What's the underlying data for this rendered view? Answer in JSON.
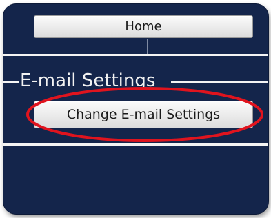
{
  "nav": {
    "home_label": "Home"
  },
  "email_settings": {
    "section_title": "E-mail Settings",
    "change_button_label": "Change E-mail Settings"
  },
  "colors": {
    "background": "#14254b",
    "divider": "#f4f4f4",
    "highlight_ellipse": "#e0141e"
  }
}
